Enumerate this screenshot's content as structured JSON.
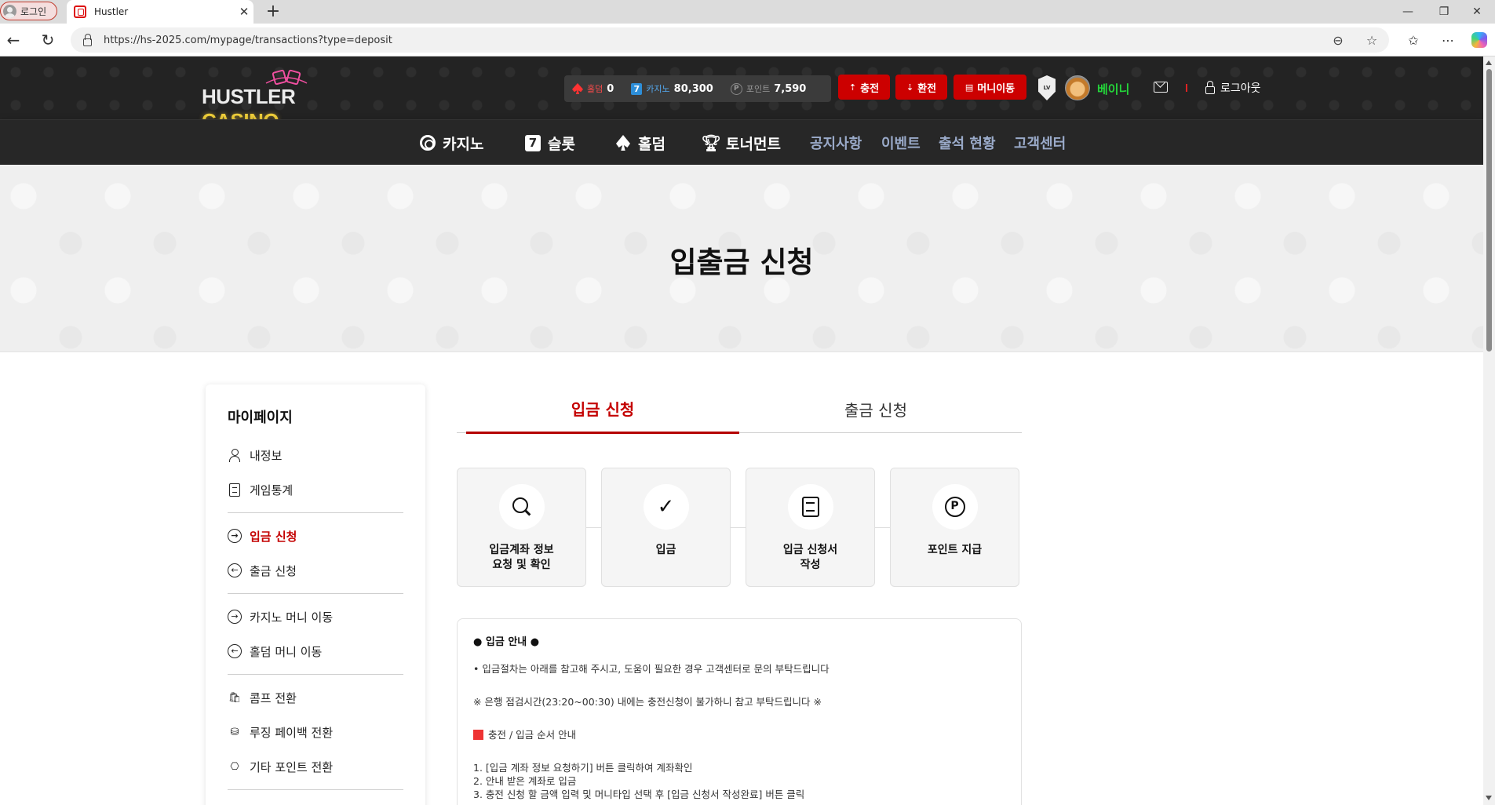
{
  "browser": {
    "profile_label": "로그인",
    "tab_title": "Hustler",
    "url": "https://hs-2025.com/mypage/transactions?type=deposit"
  },
  "header": {
    "logo_text_left": "HUSTLER",
    "logo_text_right": "CASINO",
    "balances": [
      {
        "label": "홀덤",
        "value": "0",
        "icon": "spade-icon"
      },
      {
        "label": "카지노",
        "value": "80,300",
        "icon": "seven-icon"
      },
      {
        "label": "포인트",
        "value": "7,590",
        "icon": "point-coin-icon"
      }
    ],
    "buttons": {
      "charge": "충전",
      "exchange": "환전",
      "money_move": "머니이동"
    },
    "level_badge": "LV",
    "nickname": "베이니",
    "logout": "로그아웃",
    "colors": {
      "header_bg": "#232323",
      "accent_red": "#cc0000",
      "nickname_green": "#24d43a"
    }
  },
  "nav": {
    "casino": "카지노",
    "slot": "슬롯",
    "holdem": "홀덤",
    "tournament": "토너먼트",
    "notice": "공지사항",
    "event": "이벤트",
    "attendance": "출석 현황",
    "support": "고객센터",
    "slot_glyph": "7"
  },
  "banner": {
    "title": "입출금 신청"
  },
  "sidebar": {
    "title": "마이페이지",
    "items": [
      {
        "label": "내정보"
      },
      {
        "label": "게임통계"
      },
      {
        "label": "입금 신청",
        "active": true
      },
      {
        "label": "출금 신청"
      },
      {
        "label": "카지노 머니 이동"
      },
      {
        "label": "홀덤 머니 이동"
      },
      {
        "label": "콤프 전환"
      },
      {
        "label": "루징 페이백 전환"
      },
      {
        "label": "기타 포인트 전환"
      }
    ]
  },
  "tabs": {
    "deposit": "입금 신청",
    "withdraw": "출금 신청"
  },
  "steps": [
    {
      "label": "입금계좌 정보\n요청 및 확인",
      "icon": "search-icon"
    },
    {
      "label": "입금",
      "icon": "check-icon"
    },
    {
      "label": "입금 신청서\n작성",
      "icon": "form-icon"
    },
    {
      "label": "포인트 지급",
      "icon": "point-coin-icon"
    }
  ],
  "guide": {
    "title": "● 입금 안내 ●",
    "line1": "• 입금절차는 아래를 참고해 주시고, 도움이 필요한 경우 고객센터로 문의 부탁드립니다",
    "line2": "※ 은행 점검시간(23:20~00:30) 내에는 충전신청이 불가하니 참고 부탁드립니다 ※",
    "section": "충전 / 입금 순서 안내",
    "step1": "1. [입금 계좌 정보 요청하기] 버튼 클릭하여 계좌확인",
    "step2": "2. 안내 받은 계좌로 입금",
    "step3": "3. 충전 신청 할 금액 입력 및 머니타입 선택 후 [입금 신청서 작성완료] 버튼 클릭"
  }
}
